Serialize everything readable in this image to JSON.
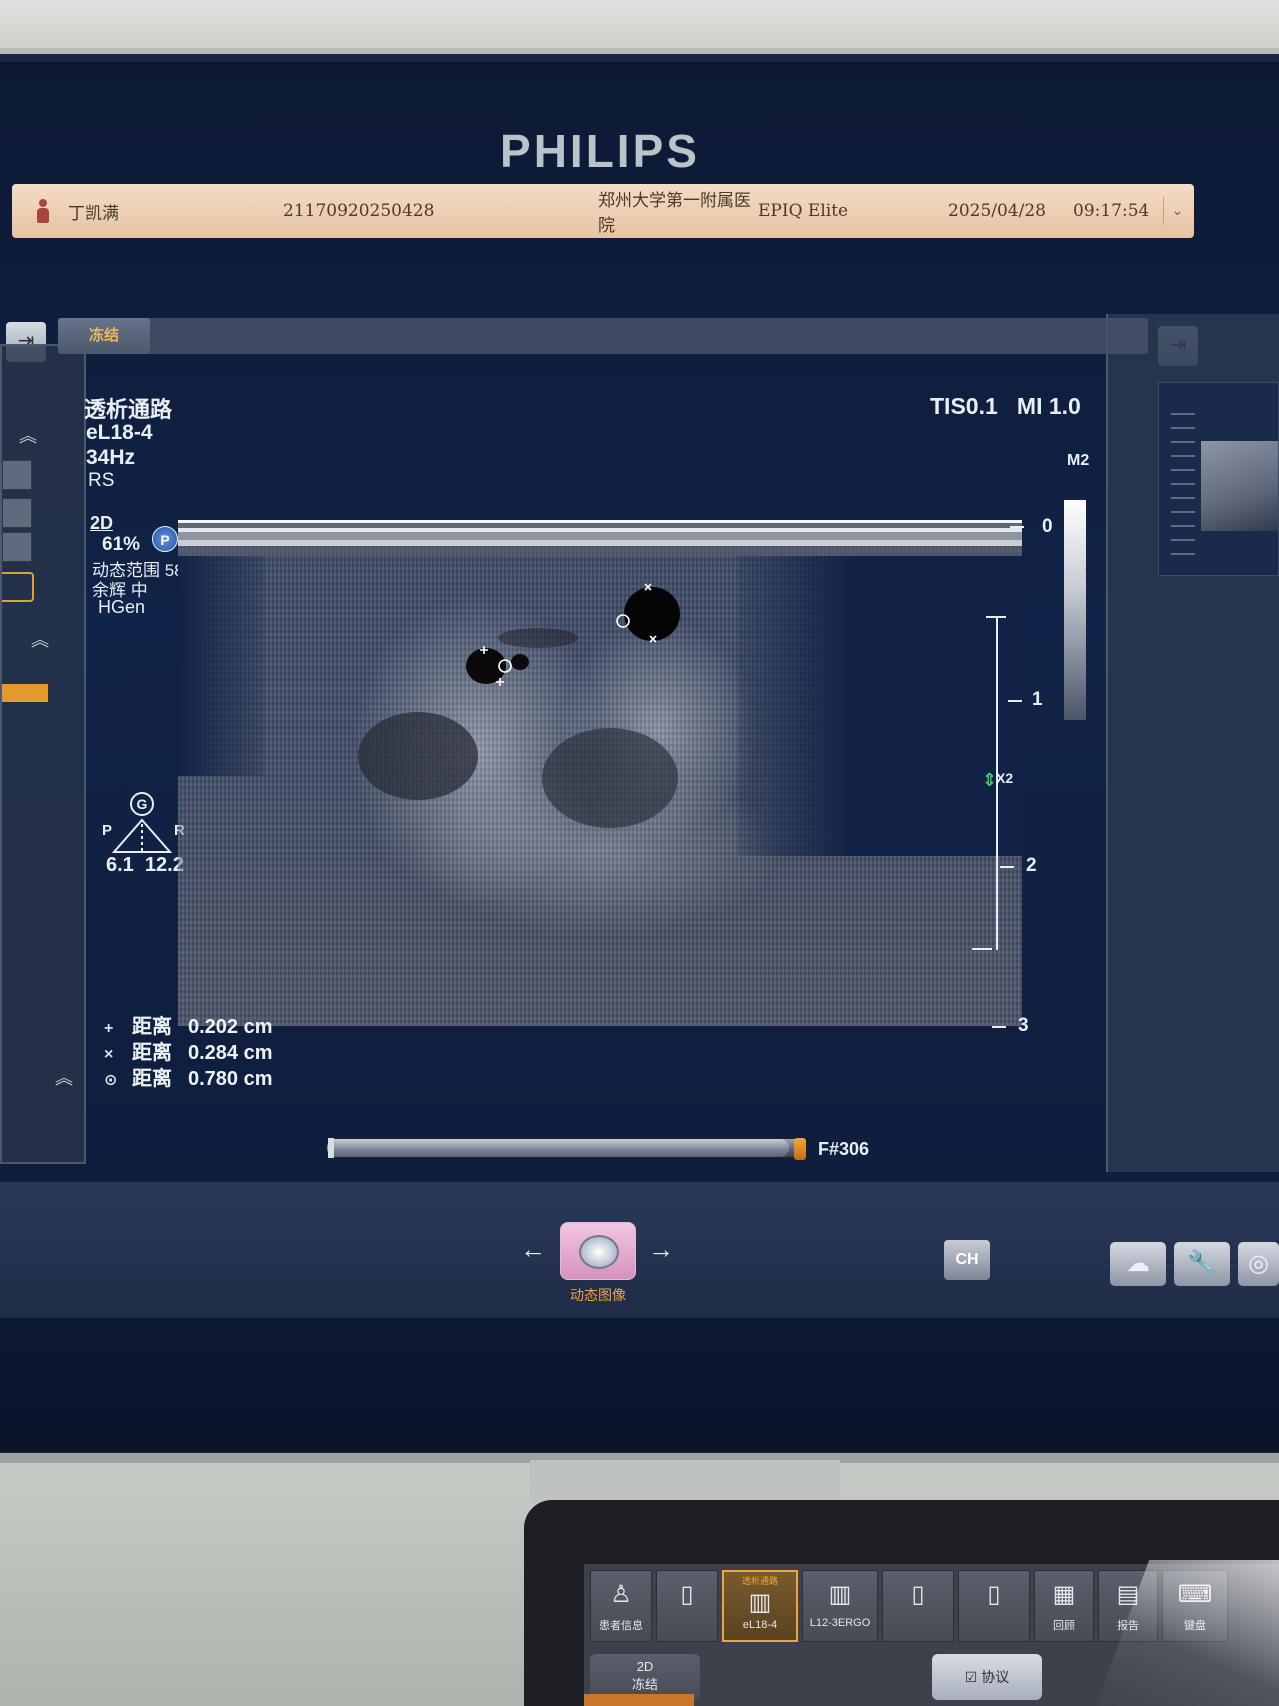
{
  "brand": "PHILIPS",
  "patient_bar": {
    "name": "丁凯满",
    "patient_id": "21170920250428",
    "hospital": "郑州大学第一附属医院",
    "system": "EPIQ Elite",
    "date": "2025/04/28",
    "time": "09:17:54",
    "expand_icon": "chevron-down-icon"
  },
  "toolbar": {
    "freeze_tab": "冻结"
  },
  "image_info": {
    "exam_preset": "透析通路",
    "probe": "eL18-4",
    "frame_rate": "34Hz",
    "resolution_mode": "RS",
    "tis_mi": "TIS0.1   MI 1.0",
    "map": "M2",
    "mode": "2D",
    "gain": "61%",
    "p_badge": "P",
    "dynamic_range": "动态范围 58",
    "persistence": "余辉 中",
    "harmonics": "HGen",
    "g_badge": "G",
    "tri_left": "P",
    "tri_right": "R",
    "tri_values": "6.1  12.2"
  },
  "measurements": [
    {
      "symbol": "+",
      "label": "距离",
      "value": "0.202 cm"
    },
    {
      "symbol": "×",
      "label": "距离",
      "value": "0.284 cm"
    },
    {
      "symbol": "⊙",
      "label": "距离",
      "value": "0.780 cm"
    }
  ],
  "depth_scale": {
    "labels": [
      "0",
      "1",
      "2",
      "3"
    ],
    "focus_label": "X2"
  },
  "cine": {
    "position": 0.97,
    "frame": "F#306"
  },
  "bottom_controls": {
    "cine_label": "动态图像",
    "left_arrow": "←",
    "right_arrow": "→",
    "ch_label": "CH",
    "tools": [
      "cloud-icon",
      "wrench-icon",
      "disc-icon"
    ]
  },
  "tablet": {
    "buttons": [
      {
        "label": "患者信息",
        "icon": "person-icon"
      },
      {
        "label": "",
        "icon": "blank-slot-icon"
      },
      {
        "label": "eL18-4",
        "sub": "透析通路",
        "icon": "linear-probe-icon",
        "selected": true
      },
      {
        "label": "L12-3ERGO",
        "icon": "linear-probe-icon"
      },
      {
        "label": "",
        "icon": "blank-slot-icon"
      },
      {
        "label": "",
        "icon": "blank-slot-icon"
      },
      {
        "label": "回顾",
        "icon": "grid-icon"
      },
      {
        "label": "报告",
        "icon": "report-icon"
      },
      {
        "label": "键盘",
        "icon": "keyboard-icon"
      }
    ],
    "mode_button": "2D\n冻结",
    "protocol_button": "协议"
  }
}
